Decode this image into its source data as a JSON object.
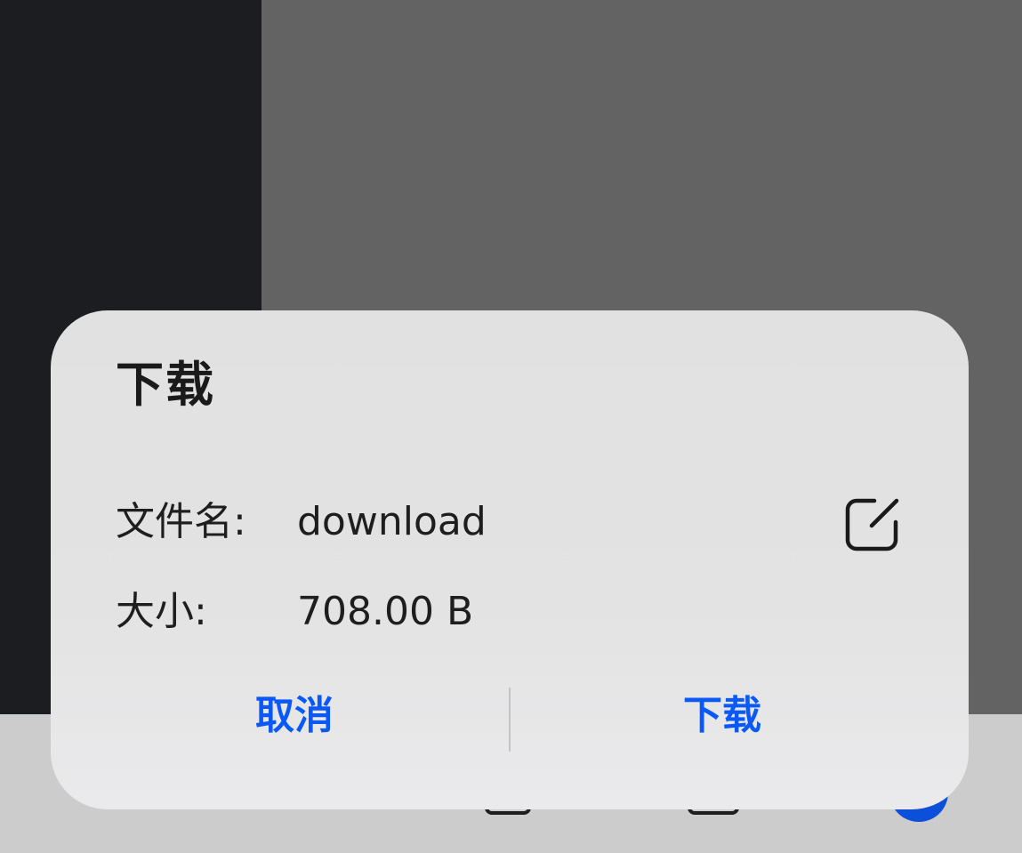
{
  "dialog": {
    "title": "下载",
    "filename_label": "文件名:",
    "filename_value": "download",
    "size_label": "大小:",
    "size_value": "708.00 B",
    "cancel_label": "取消",
    "download_label": "下载",
    "edit_icon": "edit-icon"
  },
  "colors": {
    "accent": "#0a59f7",
    "dialog_bg": "#e2e2e2",
    "left_panel_bg": "#1b1d21",
    "overlay_bg": "#636363",
    "bottom_bar_bg": "#cccccc",
    "avatar": "#0c4fd8"
  },
  "bottom_bar": {
    "icons": [
      "back-icon",
      "forward-icon",
      "tabs-icon",
      "window-icon",
      "avatar"
    ]
  }
}
